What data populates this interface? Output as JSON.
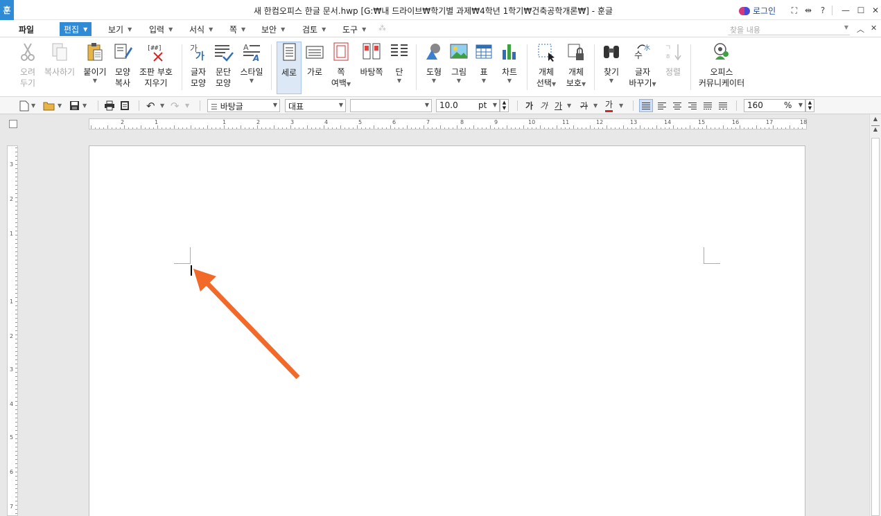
{
  "window": {
    "app_logo": "훈",
    "title": "새 한컴오피스 한글 문서.hwp [G:₩내 드라이브₩학기별 과제₩4학년 1학기₩건축공학개론₩] - 훈글",
    "login_label": "로그인"
  },
  "menu": {
    "file": "파일",
    "items": [
      "편집",
      "보기",
      "입력",
      "서식",
      "쪽",
      "보안",
      "검토",
      "도구"
    ],
    "search_placeholder": "찾을 내용"
  },
  "ribbon": {
    "cut": [
      "오려",
      "두기"
    ],
    "copy": "복사하기",
    "paste": "붙이기",
    "format_copy": [
      "모양",
      "복사"
    ],
    "clear_marks": [
      "조판 부호",
      "지우기"
    ],
    "char_shape": [
      "글자",
      "모양"
    ],
    "para_shape": [
      "문단",
      "모양"
    ],
    "style": "스타일",
    "portrait": "세로",
    "landscape": "가로",
    "page_margin": [
      "쪽",
      "여백"
    ],
    "background": "바탕쪽",
    "columns": "단",
    "shape": "도형",
    "picture": "그림",
    "table": "표",
    "chart": "차트",
    "object_select": [
      "개체",
      "선택"
    ],
    "object_protect": [
      "개체",
      "보호"
    ],
    "find": "찾기",
    "replace": [
      "글자",
      "바꾸기"
    ],
    "sort": "정렬",
    "office_communicator": [
      "오피스",
      "커뮤니케이터"
    ]
  },
  "format": {
    "style": "바탕글",
    "font_lang": "대표",
    "font_name": "",
    "font_size": "10.0",
    "font_unit": "pt",
    "bold_glyph": "가",
    "italic_glyph": "가",
    "underline_glyph": "가",
    "strike_glyph": "가",
    "color_glyph": "가",
    "zoom": "160",
    "zoom_unit": "%"
  },
  "ruler": {
    "h_labels": [
      "2",
      "1",
      "1",
      "2",
      "3",
      "4",
      "5",
      "6",
      "7",
      "8",
      "9",
      "10",
      "11",
      "12",
      "13",
      "14",
      "15",
      "16",
      "17",
      "18"
    ],
    "v_labels": [
      "3",
      "2",
      "1",
      "1",
      "2",
      "3",
      "4",
      "5",
      "6",
      "7"
    ]
  },
  "colors": {
    "accent": "#2f8bd6",
    "annotation_arrow": "#f26a2a"
  }
}
